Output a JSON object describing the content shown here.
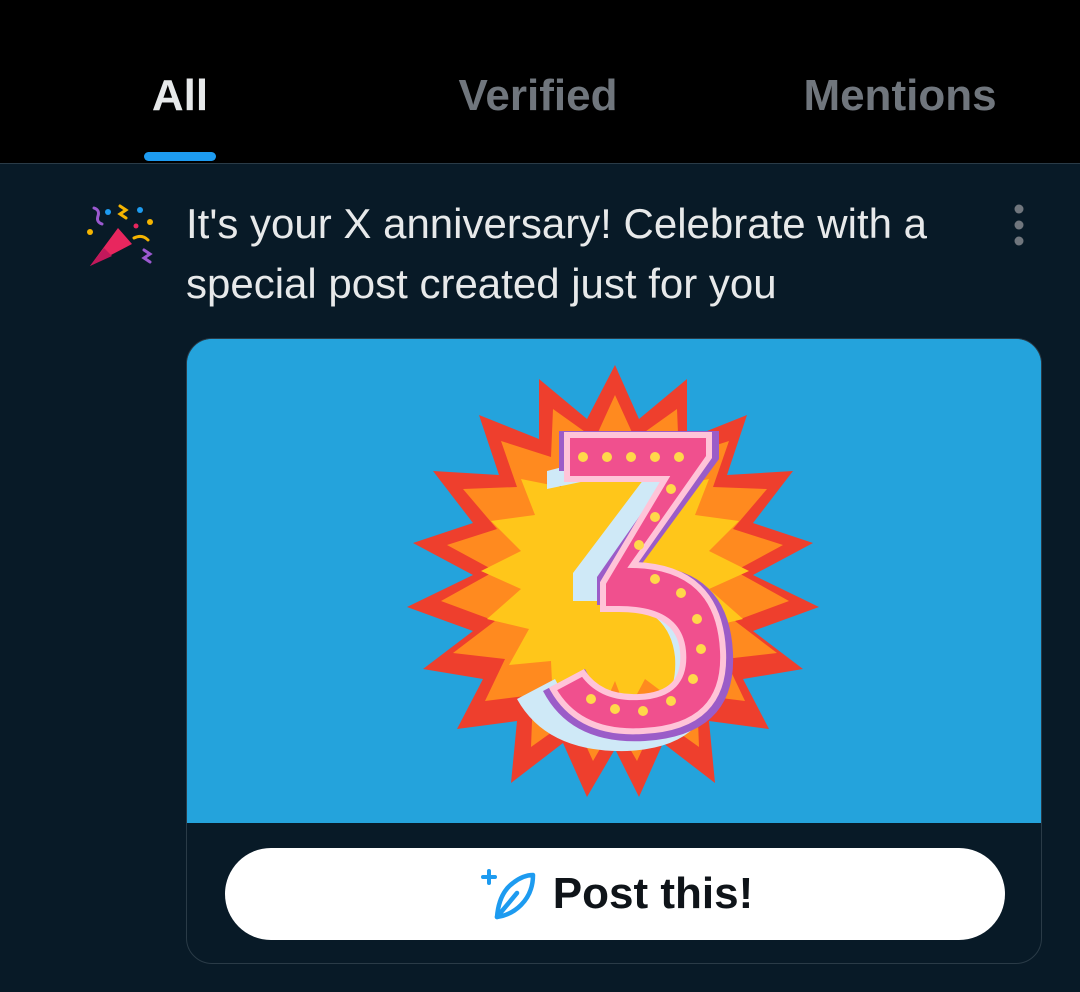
{
  "tabs": [
    {
      "label": "All",
      "active": true
    },
    {
      "label": "Verified",
      "active": false
    },
    {
      "label": "Mentions",
      "active": false
    }
  ],
  "notification": {
    "icon": "party-popper-icon",
    "text": "It's your X anniversary! Celebrate with a special post created just for you",
    "menu_icon": "more-vertical-icon"
  },
  "card": {
    "image_number": "3",
    "button_icon": "compose-post-icon",
    "button_label": "Post this!"
  },
  "colors": {
    "accent": "#1d9bf0",
    "background": "#081a27",
    "tabbar": "#000000",
    "image_background": "#24a3dc"
  }
}
